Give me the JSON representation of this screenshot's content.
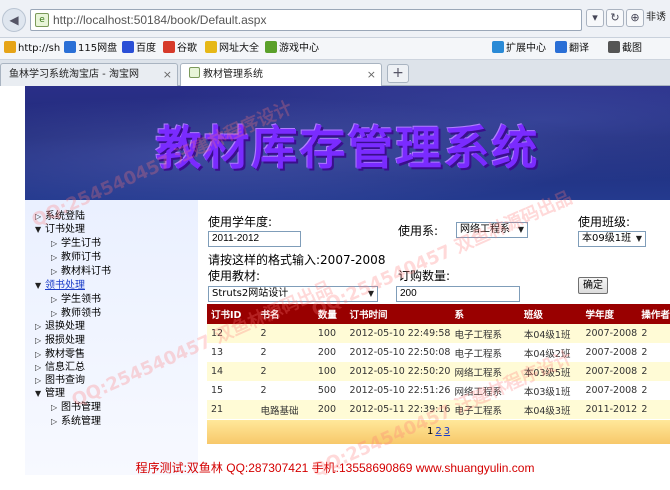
{
  "browser": {
    "url": "http://localhost:50184/book/Default.aspx",
    "tools": {
      "more_label": "非诱"
    },
    "favorites": [
      {
        "label": "http://sh",
        "color": "#e6a417"
      },
      {
        "label": "115网盘",
        "color": "#2a6fd6"
      },
      {
        "label": "百度",
        "color": "#2a4fd6"
      },
      {
        "label": "谷歌",
        "color": "#d63a2a"
      },
      {
        "label": "网址大全",
        "color": "#e6b817"
      },
      {
        "label": "游戏中心",
        "color": "#5aa02a"
      },
      {
        "label": "扩展中心",
        "color": "#2a8ad6"
      },
      {
        "label": "翻译",
        "color": "#2a6fd6"
      },
      {
        "label": "截图",
        "color": "#555555"
      }
    ],
    "tabs": [
      {
        "label": "鱼林学习系统淘宝店 - 淘宝网"
      },
      {
        "label": "教材管理系统"
      }
    ]
  },
  "banner": {
    "title": "教材库存管理系统"
  },
  "menu": {
    "items": [
      {
        "label": "系统登陆",
        "level": 0,
        "arrow": "▷",
        "link": false
      },
      {
        "label": "订书处理",
        "level": 0,
        "arrow": "▼",
        "link": false
      },
      {
        "label": "学生订书",
        "level": 1,
        "arrow": "▷",
        "link": false
      },
      {
        "label": "教师订书",
        "level": 1,
        "arrow": "▷",
        "link": false
      },
      {
        "label": "教材料订书",
        "level": 1,
        "arrow": "▷",
        "link": false
      },
      {
        "label": "领书处理",
        "level": 0,
        "arrow": "▼",
        "link": true
      },
      {
        "label": "学生领书",
        "level": 1,
        "arrow": "▷",
        "link": false
      },
      {
        "label": "教师领书",
        "level": 1,
        "arrow": "▷",
        "link": false
      },
      {
        "label": "退换处理",
        "level": 0,
        "arrow": "▷",
        "link": false
      },
      {
        "label": "报损处理",
        "level": 0,
        "arrow": "▷",
        "link": false
      },
      {
        "label": "教材零售",
        "level": 0,
        "arrow": "▷",
        "link": false
      },
      {
        "label": "信息汇总",
        "level": 0,
        "arrow": "▷",
        "link": false
      },
      {
        "label": "图书查询",
        "level": 0,
        "arrow": "▷",
        "link": false
      },
      {
        "label": "管理",
        "level": 0,
        "arrow": "▼",
        "link": false
      },
      {
        "label": "图书管理",
        "level": 1,
        "arrow": "▷",
        "link": false
      },
      {
        "label": "系统管理",
        "level": 1,
        "arrow": "▷",
        "link": false
      }
    ]
  },
  "form": {
    "year_label": "使用学年度:",
    "year_value": "2011-2012",
    "year_hint": "请按这样的格式输入:2007-2008",
    "dept_label": "使用系:",
    "dept_value": "网络工程系",
    "class_label": "使用班级:",
    "class_value": "本09级1班",
    "book_label": "使用教材:",
    "book_value": "Struts2网站设计",
    "qty_label": "订购数量:",
    "qty_value": "200",
    "confirm_label": "确定"
  },
  "table": {
    "columns": [
      "订书ID",
      "书名",
      "数量",
      "订书时间",
      "系",
      "班级",
      "学年度",
      "操作者"
    ],
    "rows": [
      [
        "12",
        "2",
        "100",
        "2012-05-10 22:49:58",
        "电子工程系",
        "本04级1班",
        "2007-2008",
        "2"
      ],
      [
        "13",
        "2",
        "200",
        "2012-05-10 22:50:08",
        "电子工程系",
        "本04级2班",
        "2007-2008",
        "2"
      ],
      [
        "14",
        "2",
        "100",
        "2012-05-10 22:50:20",
        "网络工程系",
        "本03级5班",
        "2007-2008",
        "2"
      ],
      [
        "15",
        "2",
        "500",
        "2012-05-10 22:51:26",
        "网络工程系",
        "本03级1班",
        "2007-2008",
        "2"
      ],
      [
        "21",
        "电路基础",
        "200",
        "2012-05-11 22:39:16",
        "电子工程系",
        "本04级3班",
        "2011-2012",
        "2"
      ]
    ]
  },
  "pager": {
    "current": "1",
    "pages": [
      "2",
      "3"
    ]
  },
  "footer": {
    "text": "程序测试:双鱼林 QQ:287307421 手机:13558690869 www.shuangyulin.com"
  },
  "watermark": {
    "text_a": "QQ:254540457 汪建林程序设计",
    "text_b": "QQ:254540457 双鱼林源码出品"
  }
}
